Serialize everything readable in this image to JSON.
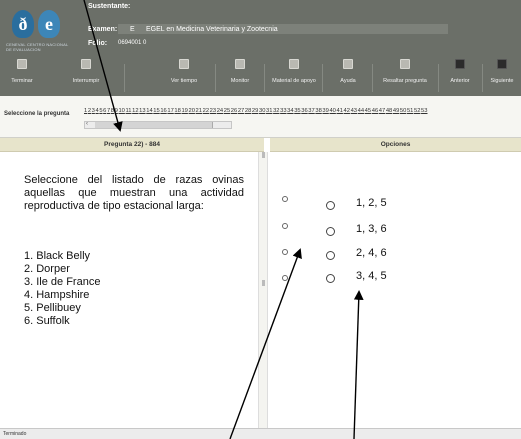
{
  "header": {
    "logo_caption": "CENEVAL  CENTRO NACIONAL DE EVALUACION",
    "labels": {
      "candidate": "Sustentante:",
      "exam": "Examen:",
      "folio": "Folio:"
    },
    "exam_code": "E",
    "exam_name": "EGEL en Medicina Veterinaria y Zootecnia",
    "folio_value": "0694001 0"
  },
  "toolbar": {
    "items": [
      {
        "label": "Terminar"
      },
      {
        "label": "Interrumpir"
      },
      {
        "label": "Ver tiempo"
      },
      {
        "label": "Monitor"
      },
      {
        "label": "Material de apoyo"
      },
      {
        "label": "Ayuda"
      },
      {
        "label": "Resaltar pregunta"
      },
      {
        "label": "Anterior"
      },
      {
        "label": "Siguiente"
      }
    ]
  },
  "selector": {
    "label": "Seleccione la pregunta",
    "questions": [
      "1",
      "2",
      "3",
      "4",
      "5",
      "6",
      "7",
      "8",
      "9",
      "10",
      "11",
      "12",
      "13",
      "14",
      "15",
      "16",
      "17",
      "18",
      "19",
      "20",
      "21",
      "22",
      "23",
      "24",
      "25",
      "26",
      "27",
      "28",
      "29",
      "30",
      "31",
      "32",
      "33",
      "34",
      "35",
      "36",
      "37",
      "38",
      "39",
      "40",
      "41",
      "42",
      "43",
      "44",
      "45",
      "46",
      "47",
      "48",
      "49",
      "50",
      "51",
      "52",
      "53"
    ]
  },
  "question_panel": {
    "title": "Pregunta 22) - 884",
    "stem": "Seleccione del listado de razas ovinas aquellas que muestran una actividad reproductiva de tipo estacional larga:",
    "items": [
      "1. Black Belly",
      "2. Dorper",
      "3. Ile de France",
      "4. Hampshire",
      "5. Pellibuey",
      "6. Suffolk"
    ]
  },
  "options_panel": {
    "title": "Opciones",
    "options": [
      "1, 2, 5",
      "1, 3, 6",
      "2, 4, 6",
      "3, 4, 5"
    ]
  },
  "status": {
    "text": "Terminado"
  },
  "colors": {
    "header_bg": "#6b6f68",
    "panel_head_bg": "#e7e4cb"
  }
}
